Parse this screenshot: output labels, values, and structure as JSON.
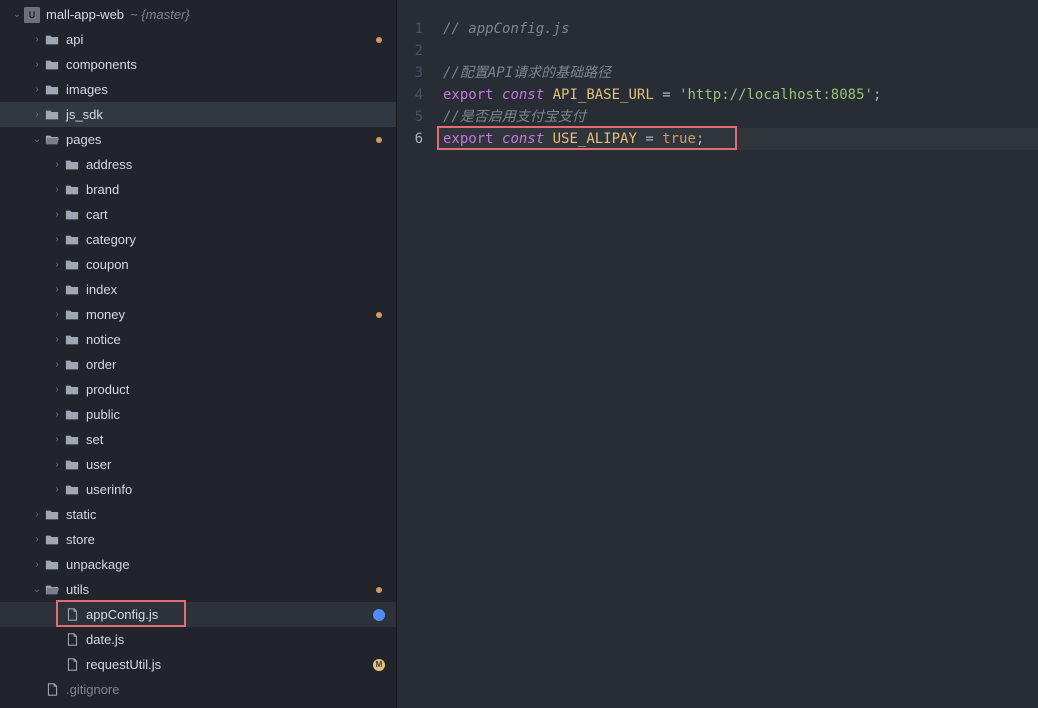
{
  "project": {
    "name": "mall-app-web",
    "branch": "{master}"
  },
  "tree": [
    {
      "indent": 0,
      "kind": "project",
      "name": "mall-app-web",
      "suffix": "~ {master}",
      "toggle": "down"
    },
    {
      "indent": 1,
      "kind": "folder",
      "name": "api",
      "toggle": "right",
      "dirty": true
    },
    {
      "indent": 1,
      "kind": "folder",
      "name": "components",
      "toggle": "right"
    },
    {
      "indent": 1,
      "kind": "folder",
      "name": "images",
      "toggle": "right"
    },
    {
      "indent": 1,
      "kind": "folder",
      "name": "js_sdk",
      "toggle": "right",
      "selected": "dark"
    },
    {
      "indent": 1,
      "kind": "folder",
      "name": "pages",
      "toggle": "down",
      "dirty": true
    },
    {
      "indent": 2,
      "kind": "folder",
      "name": "address",
      "toggle": "right"
    },
    {
      "indent": 2,
      "kind": "folder",
      "name": "brand",
      "toggle": "right"
    },
    {
      "indent": 2,
      "kind": "folder",
      "name": "cart",
      "toggle": "right"
    },
    {
      "indent": 2,
      "kind": "folder",
      "name": "category",
      "toggle": "right"
    },
    {
      "indent": 2,
      "kind": "folder",
      "name": "coupon",
      "toggle": "right"
    },
    {
      "indent": 2,
      "kind": "folder",
      "name": "index",
      "toggle": "right"
    },
    {
      "indent": 2,
      "kind": "folder",
      "name": "money",
      "toggle": "right",
      "dirty": true
    },
    {
      "indent": 2,
      "kind": "folder",
      "name": "notice",
      "toggle": "right"
    },
    {
      "indent": 2,
      "kind": "folder",
      "name": "order",
      "toggle": "right"
    },
    {
      "indent": 2,
      "kind": "folder",
      "name": "product",
      "toggle": "right"
    },
    {
      "indent": 2,
      "kind": "folder",
      "name": "public",
      "toggle": "right"
    },
    {
      "indent": 2,
      "kind": "folder",
      "name": "set",
      "toggle": "right"
    },
    {
      "indent": 2,
      "kind": "folder",
      "name": "user",
      "toggle": "right"
    },
    {
      "indent": 2,
      "kind": "folder",
      "name": "userinfo",
      "toggle": "right"
    },
    {
      "indent": 1,
      "kind": "folder",
      "name": "static",
      "toggle": "right"
    },
    {
      "indent": 1,
      "kind": "folder",
      "name": "store",
      "toggle": "right"
    },
    {
      "indent": 1,
      "kind": "folder",
      "name": "unpackage",
      "toggle": "right"
    },
    {
      "indent": 1,
      "kind": "folder",
      "name": "utils",
      "toggle": "down",
      "dirty": true
    },
    {
      "indent": 2,
      "kind": "file",
      "name": "appConfig.js",
      "selected": "blue",
      "badge": "blue",
      "redbox": true
    },
    {
      "indent": 2,
      "kind": "file",
      "name": "date.js"
    },
    {
      "indent": 2,
      "kind": "file",
      "name": "requestUtil.js",
      "badge": "gold",
      "badgeText": "M"
    },
    {
      "indent": 1,
      "kind": "file-dim",
      "name": ".gitignore"
    }
  ],
  "editor": {
    "lines": [
      {
        "n": 1,
        "tokens": [
          {
            "cls": "tok-comment",
            "text": "// appConfig.js"
          }
        ]
      },
      {
        "n": 2,
        "tokens": []
      },
      {
        "n": 3,
        "tokens": [
          {
            "cls": "tok-comment",
            "text": "//配置API请求的基础路径"
          }
        ]
      },
      {
        "n": 4,
        "tokens": [
          {
            "cls": "tok-keyword",
            "text": "export"
          },
          {
            "cls": "tok-op",
            "text": " "
          },
          {
            "cls": "tok-type",
            "text": "const"
          },
          {
            "cls": "tok-op",
            "text": " "
          },
          {
            "cls": "tok-id",
            "text": "API_BASE_URL"
          },
          {
            "cls": "tok-op",
            "text": " = "
          },
          {
            "cls": "tok-string",
            "text": "'http://localhost:8085'"
          },
          {
            "cls": "tok-op",
            "text": ";"
          }
        ]
      },
      {
        "n": 5,
        "tokens": [
          {
            "cls": "tok-comment",
            "text": "//是否启用支付宝支付"
          }
        ]
      },
      {
        "n": 6,
        "highlight": true,
        "tokens": [
          {
            "cls": "tok-keyword",
            "text": "export"
          },
          {
            "cls": "tok-op",
            "text": " "
          },
          {
            "cls": "tok-type",
            "text": "const"
          },
          {
            "cls": "tok-op",
            "text": " "
          },
          {
            "cls": "tok-id",
            "text": "USE_ALIPAY"
          },
          {
            "cls": "tok-op",
            "text": " = "
          },
          {
            "cls": "tok-bool",
            "text": "true"
          },
          {
            "cls": "tok-op",
            "text": ";"
          }
        ]
      }
    ],
    "redbox_line": 6
  }
}
